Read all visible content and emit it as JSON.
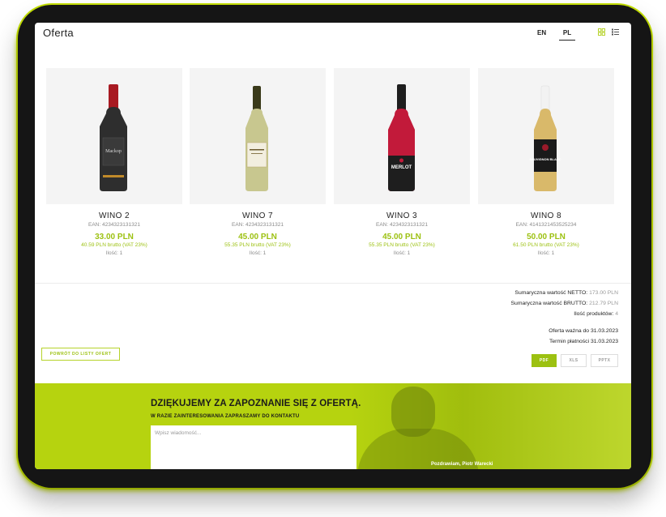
{
  "header": {
    "brand": "Oferta",
    "languages": [
      "EN",
      "PL"
    ],
    "active_language": "PL",
    "view_modes": [
      "grid-icon",
      "list-icon"
    ]
  },
  "products": [
    {
      "name": "WINO 2",
      "ean": "EAN: 4234323131321",
      "price_net": "33.00 PLN",
      "price_gross": "40.59 PLN brutto (VAT 23%)",
      "quantity": "Ilość: 1",
      "bottle_label": "Mackop",
      "bottle_color": "#2e2e2e",
      "neck_color": "#a81a22"
    },
    {
      "name": "WINO 7",
      "ean": "EAN: 4234323131321",
      "price_net": "45.00 PLN",
      "price_gross": "55.35 PLN brutto (VAT 23%)",
      "quantity": "Ilość: 1",
      "bottle_label": "",
      "bottle_color": "#c8c78f",
      "neck_color": "#3a3a1a"
    },
    {
      "name": "WINO 3",
      "ean": "EAN: 4234323131321",
      "price_net": "45.00 PLN",
      "price_gross": "55.35 PLN brutto (VAT 23%)",
      "quantity": "Ilość: 1",
      "bottle_label": "MERLOT",
      "bottle_color": "#c21a3a",
      "neck_color": "#1e1e1e"
    },
    {
      "name": "WINO 8",
      "ean": "EAN: 4141321453525234",
      "price_net": "50.00 PLN",
      "price_gross": "61.50 PLN brutto (VAT 23%)",
      "quantity": "Ilość: 1",
      "bottle_label": "SAUVIGNON BLANC",
      "bottle_color": "#d9b96a",
      "neck_color": "#f2f2f2"
    }
  ],
  "summary": {
    "netto_label": "Sumaryczna wartość NETTO:",
    "netto_value": "173.00 PLN",
    "brutto_label": "Sumaryczna wartość BRUTTO:",
    "brutto_value": "212.79 PLN",
    "count_label": "Ilość produktów:",
    "count_value": "4",
    "valid_label": "Oferta ważna do 31.03.2023",
    "payment_label": "Termin płatności 31.03.2023"
  },
  "actions": {
    "back_label": "POWRÓT DO LISTY OFERT",
    "export_pdf": "PDF",
    "export_xls": "XLS",
    "export_pptx": "PPTX"
  },
  "footer": {
    "thanks": "DZIĘKUJEMY ZA ZAPOZNANIE SIĘ Z OFERTĄ.",
    "subtitle": "W RAZIE ZAINTERESOWANIA ZAPRASZAMY DO KONTAKTU",
    "message_placeholder": "Wpisz wiadomość...",
    "regards": "Pozdrawiam, Piotr Warecki"
  },
  "colors": {
    "accent": "#9cc111",
    "footer_bg": "#b6d30f",
    "frame_glow": "#c5e100"
  }
}
